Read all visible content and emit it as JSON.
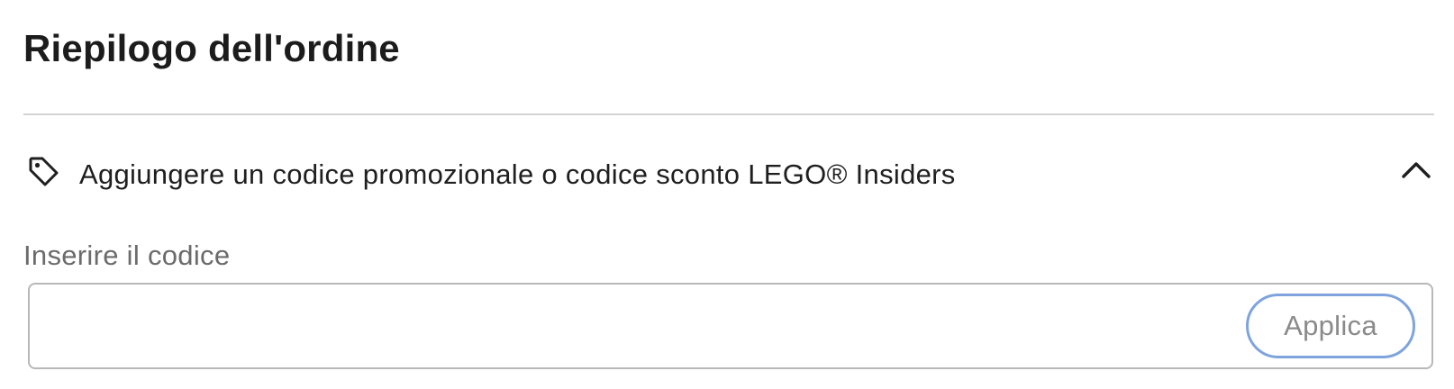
{
  "order_summary": {
    "title": "Riepilogo dell'ordine"
  },
  "promo": {
    "toggle_label": "Aggiungere un codice promozionale o codice sconto LEGO® Insiders",
    "expanded": true,
    "icon": "tag-icon",
    "toggle_icon": "chevron-up-icon",
    "field_label": "Inserire il codice",
    "input_value": "",
    "apply_label": "Applica"
  },
  "colors": {
    "apply_focus_ring": "#7ea3dd",
    "divider": "#d3d3d3",
    "input_border": "#b8b8b8"
  }
}
